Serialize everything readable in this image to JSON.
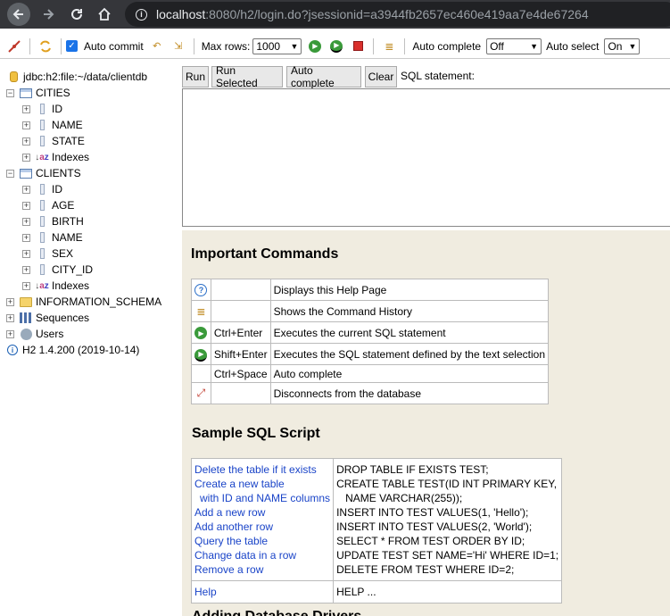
{
  "browser": {
    "url_host": "localhost",
    "url_rest": ":8080/h2/login.do?jsessionid=a3944fb2657ec460e419aa7e4de67264"
  },
  "toolbar": {
    "auto_commit_label": "Auto commit",
    "auto_commit_checked": true,
    "max_rows_label": "Max rows:",
    "max_rows_value": "1000",
    "auto_complete_label": "Auto complete",
    "auto_complete_value": "Off",
    "auto_select_label": "Auto select",
    "auto_select_value": "On"
  },
  "tree": {
    "connection": "jdbc:h2:file:~/data/clientdb",
    "tables": [
      {
        "name": "CITIES",
        "columns": [
          "ID",
          "NAME",
          "STATE"
        ],
        "indexes_label": "Indexes"
      },
      {
        "name": "CLIENTS",
        "columns": [
          "ID",
          "AGE",
          "BIRTH",
          "NAME",
          "SEX",
          "CITY_ID"
        ],
        "indexes_label": "Indexes"
      }
    ],
    "information_schema": "INFORMATION_SCHEMA",
    "sequences": "Sequences",
    "users": "Users",
    "version": "H2 1.4.200 (2019-10-14)"
  },
  "query": {
    "run": "Run",
    "run_selected": "Run Selected",
    "auto_complete": "Auto complete",
    "clear": "Clear",
    "sql_statement_label": "SQL statement:"
  },
  "help": {
    "important_title": "Important Commands",
    "commands": [
      {
        "icon": "help-icon",
        "key": "",
        "desc": "Displays this Help Page"
      },
      {
        "icon": "history-icon",
        "key": "",
        "desc": "Shows the Command History"
      },
      {
        "icon": "run-icon",
        "key": "Ctrl+Enter",
        "desc": "Executes the current SQL statement"
      },
      {
        "icon": "run-selected-icon",
        "key": "Shift+Enter",
        "desc": "Executes the SQL statement defined by the text selection"
      },
      {
        "icon": "",
        "key": "Ctrl+Space",
        "desc": "Auto complete"
      },
      {
        "icon": "disconnect-icon",
        "key": "",
        "desc": "Disconnects from the database"
      }
    ],
    "sample_title": "Sample SQL Script",
    "sample": {
      "links": [
        "Delete the table if it exists",
        "Create a new table",
        "with ID and NAME columns",
        "Add a new row",
        "Add another row",
        "Query the table",
        "Change data in a row",
        "Remove a row"
      ],
      "sql": [
        "DROP TABLE IF EXISTS TEST;",
        "CREATE TABLE TEST(ID INT PRIMARY KEY,",
        "NAME VARCHAR(255));",
        "INSERT INTO TEST VALUES(1, 'Hello');",
        "INSERT INTO TEST VALUES(2, 'World');",
        "SELECT * FROM TEST ORDER BY ID;",
        "UPDATE TEST SET NAME='Hi' WHERE ID=1;",
        "DELETE FROM TEST WHERE ID=2;"
      ],
      "help_link": "Help",
      "help_sql": "HELP ..."
    },
    "next_title": "Adding Database Drivers"
  }
}
